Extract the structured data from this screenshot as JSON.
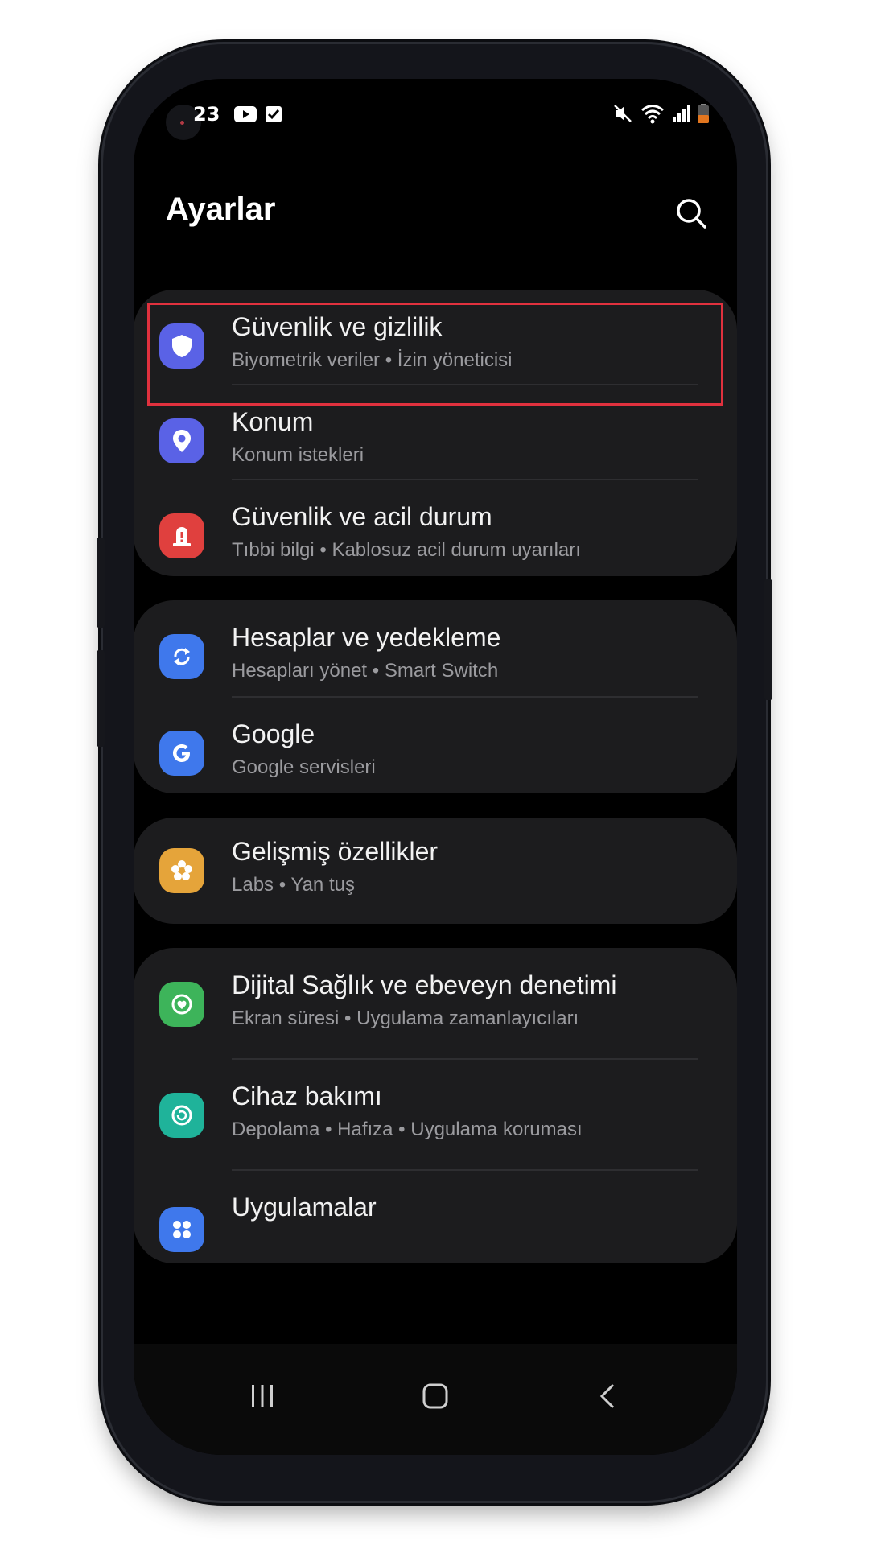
{
  "status_bar": {
    "time": "23"
  },
  "header": {
    "title": "Ayarlar"
  },
  "groups": [
    {
      "items": [
        {
          "title": "Güvenlik ve gizlilik",
          "subtitle": "Biyometrik veriler  •  İzin yöneticisi",
          "icon": "shield-icon",
          "color": "#5a62e6",
          "highlighted": true
        },
        {
          "title": "Konum",
          "subtitle": "Konum istekleri",
          "icon": "location-pin-icon",
          "color": "#5a62e6"
        },
        {
          "title": "Güvenlik ve acil durum",
          "subtitle": "Tıbbi bilgi  •  Kablosuz acil durum uyarıları",
          "icon": "emergency-icon",
          "color": "#e0403e"
        }
      ]
    },
    {
      "items": [
        {
          "title": "Hesaplar ve yedekleme",
          "subtitle": "Hesapları yönet  •  Smart Switch",
          "icon": "sync-icon",
          "color": "#3f78ec"
        },
        {
          "title": "Google",
          "subtitle": "Google servisleri",
          "icon": "google-icon",
          "color": "#3f78ec"
        }
      ]
    },
    {
      "items": [
        {
          "title": "Gelişmiş özellikler",
          "subtitle": "Labs  •  Yan tuş",
          "icon": "gear-flower-icon",
          "color": "#e5a43a"
        }
      ]
    },
    {
      "items": [
        {
          "title": "Dijital Sağlık ve ebeveyn denetimi",
          "subtitle": "Ekran süresi  •  Uygulama zamanlayıcıları",
          "icon": "digital-wellbeing-icon",
          "color": "#3db45a"
        },
        {
          "title": "Cihaz bakımı",
          "subtitle": "Depolama  •  Hafıza  •  Uygulama koruması",
          "icon": "device-care-icon",
          "color": "#1fb39a"
        },
        {
          "title": "Uygulamalar",
          "subtitle": "",
          "icon": "apps-icon",
          "color": "#3f78ec"
        }
      ]
    }
  ]
}
